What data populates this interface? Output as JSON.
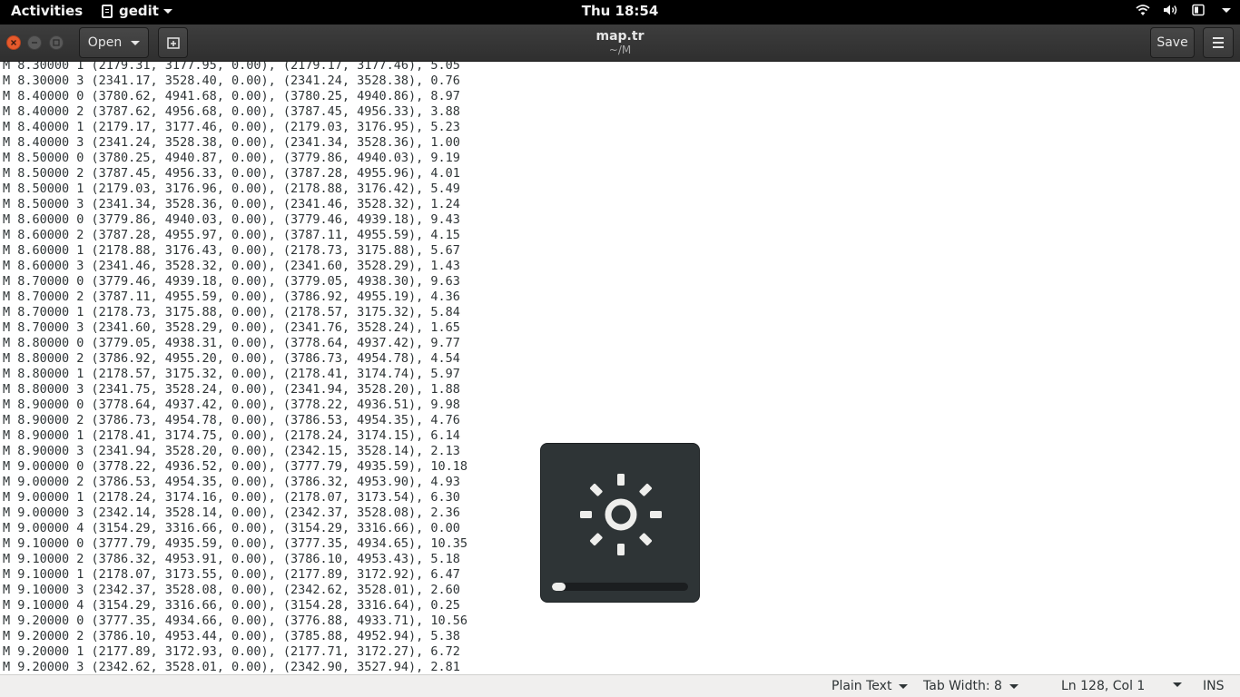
{
  "topbar": {
    "activities": "Activities",
    "app_name": "gedit",
    "clock": "Thu 18:54",
    "tray_icons": [
      "wifi-icon",
      "volume-icon",
      "battery-icon",
      "system-menu-caret-icon"
    ]
  },
  "window": {
    "title": "map.tr",
    "subtitle": "~/M",
    "open_label": "Open",
    "save_label": "Save"
  },
  "editor": {
    "lines": [
      "M 8.30000 1 (2179.31, 3177.95, 0.00), (2179.17, 3177.46), 5.05",
      "M 8.30000 3 (2341.17, 3528.40, 0.00), (2341.24, 3528.38), 0.76",
      "M 8.40000 0 (3780.62, 4941.68, 0.00), (3780.25, 4940.86), 8.97",
      "M 8.40000 2 (3787.62, 4956.68, 0.00), (3787.45, 4956.33), 3.88",
      "M 8.40000 1 (2179.17, 3177.46, 0.00), (2179.03, 3176.95), 5.23",
      "M 8.40000 3 (2341.24, 3528.38, 0.00), (2341.34, 3528.36), 1.00",
      "M 8.50000 0 (3780.25, 4940.87, 0.00), (3779.86, 4940.03), 9.19",
      "M 8.50000 2 (3787.45, 4956.33, 0.00), (3787.28, 4955.96), 4.01",
      "M 8.50000 1 (2179.03, 3176.96, 0.00), (2178.88, 3176.42), 5.49",
      "M 8.50000 3 (2341.34, 3528.36, 0.00), (2341.46, 3528.32), 1.24",
      "M 8.60000 0 (3779.86, 4940.03, 0.00), (3779.46, 4939.18), 9.43",
      "M 8.60000 2 (3787.28, 4955.97, 0.00), (3787.11, 4955.59), 4.15",
      "M 8.60000 1 (2178.88, 3176.43, 0.00), (2178.73, 3175.88), 5.67",
      "M 8.60000 3 (2341.46, 3528.32, 0.00), (2341.60, 3528.29), 1.43",
      "M 8.70000 0 (3779.46, 4939.18, 0.00), (3779.05, 4938.30), 9.63",
      "M 8.70000 2 (3787.11, 4955.59, 0.00), (3786.92, 4955.19), 4.36",
      "M 8.70000 1 (2178.73, 3175.88, 0.00), (2178.57, 3175.32), 5.84",
      "M 8.70000 3 (2341.60, 3528.29, 0.00), (2341.76, 3528.24), 1.65",
      "M 8.80000 0 (3779.05, 4938.31, 0.00), (3778.64, 4937.42), 9.77",
      "M 8.80000 2 (3786.92, 4955.20, 0.00), (3786.73, 4954.78), 4.54",
      "M 8.80000 1 (2178.57, 3175.32, 0.00), (2178.41, 3174.74), 5.97",
      "M 8.80000 3 (2341.75, 3528.24, 0.00), (2341.94, 3528.20), 1.88",
      "M 8.90000 0 (3778.64, 4937.42, 0.00), (3778.22, 4936.51), 9.98",
      "M 8.90000 2 (3786.73, 4954.78, 0.00), (3786.53, 4954.35), 4.76",
      "M 8.90000 1 (2178.41, 3174.75, 0.00), (2178.24, 3174.15), 6.14",
      "M 8.90000 3 (2341.94, 3528.20, 0.00), (2342.15, 3528.14), 2.13",
      "M 9.00000 0 (3778.22, 4936.52, 0.00), (3777.79, 4935.59), 10.18",
      "M 9.00000 2 (3786.53, 4954.35, 0.00), (3786.32, 4953.90), 4.93",
      "M 9.00000 1 (2178.24, 3174.16, 0.00), (2178.07, 3173.54), 6.30",
      "M 9.00000 3 (2342.14, 3528.14, 0.00), (2342.37, 3528.08), 2.36",
      "M 9.00000 4 (3154.29, 3316.66, 0.00), (3154.29, 3316.66), 0.00",
      "M 9.10000 0 (3777.79, 4935.59, 0.00), (3777.35, 4934.65), 10.35",
      "M 9.10000 2 (3786.32, 4953.91, 0.00), (3786.10, 4953.43), 5.18",
      "M 9.10000 1 (2178.07, 3173.55, 0.00), (2177.89, 3172.92), 6.47",
      "M 9.10000 3 (2342.37, 3528.08, 0.00), (2342.62, 3528.01), 2.60",
      "M 9.10000 4 (3154.29, 3316.66, 0.00), (3154.28, 3316.64), 0.25",
      "M 9.20000 0 (3777.35, 4934.66, 0.00), (3776.88, 4933.71), 10.56",
      "M 9.20000 2 (3786.10, 4953.44, 0.00), (3785.88, 4952.94), 5.38",
      "M 9.20000 1 (2177.89, 3172.93, 0.00), (2177.71, 3172.27), 6.72",
      "M 9.20000 3 (2342.62, 3528.01, 0.00), (2342.90, 3527.94), 2.81"
    ]
  },
  "statusbar": {
    "language": "Plain Text",
    "tab_width": "Tab Width: 8",
    "position": "Ln 128, Col 1",
    "mode": "INS"
  },
  "osd": {
    "icon": "brightness-icon",
    "level_fraction": 0.1
  },
  "colors": {
    "close_button": "#e65a2c",
    "headerbar": "#353535",
    "osd_background": "#2e3436"
  }
}
